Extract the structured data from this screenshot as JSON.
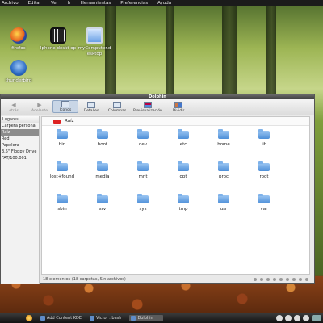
{
  "menu": [
    "Archivo",
    "Editar",
    "Ver",
    "Ir",
    "Herramientas",
    "Preferencias",
    "Ayuda"
  ],
  "desktop": {
    "icons": [
      {
        "label": "firefox",
        "icon": "firefox-icon"
      },
      {
        "label": "thunderbird",
        "icon": "thunderbird-icon"
      },
      {
        "label": "Iphone deskt op",
        "icon": "film-icon"
      },
      {
        "label": "myComputer.d esktop",
        "icon": "monitor-icon"
      }
    ]
  },
  "window": {
    "title": "Dolphin",
    "toolbar": [
      {
        "label": "Atrás",
        "icon": "back-arrow-icon",
        "enabled": false
      },
      {
        "label": "Adelante",
        "icon": "forward-arrow-icon",
        "enabled": false
      },
      {
        "label": "Iconos",
        "icon": "icons-view-icon",
        "active": true
      },
      {
        "label": "Detalles",
        "icon": "details-view-icon"
      },
      {
        "label": "Columnas",
        "icon": "columns-view-icon"
      },
      {
        "label": "Previsualización",
        "icon": "preview-icon"
      },
      {
        "label": "Dividir",
        "icon": "split-icon"
      }
    ],
    "places_header": "Lugares",
    "places": [
      {
        "label": "Carpeta personal"
      },
      {
        "label": "Raíz",
        "selected": true
      },
      {
        "label": "Red"
      },
      {
        "label": "Papelera"
      },
      {
        "label": "3,5\" Floppy Drive"
      },
      {
        "label": "FAT/100.001"
      }
    ],
    "breadcrumb": "Raíz",
    "files": [
      "bin",
      "boot",
      "dev",
      "etc",
      "home",
      "lib",
      "lost+found",
      "media",
      "mnt",
      "opt",
      "proc",
      "root",
      "sbin",
      "srv",
      "sys",
      "tmp",
      "usr",
      "var"
    ],
    "status": "18 elementos (18 carpetas, Sin archivos)"
  },
  "taskbar": {
    "tasks": [
      {
        "label": "Add Content KDE"
      },
      {
        "label": "Victor : bash"
      },
      {
        "label": "Dolphin",
        "active": true
      }
    ]
  },
  "colors": {
    "menubar": "#1b1b1b",
    "taskbar": "#121212",
    "folder": "#4d8fd8",
    "selection": "#8c8c8c"
  }
}
